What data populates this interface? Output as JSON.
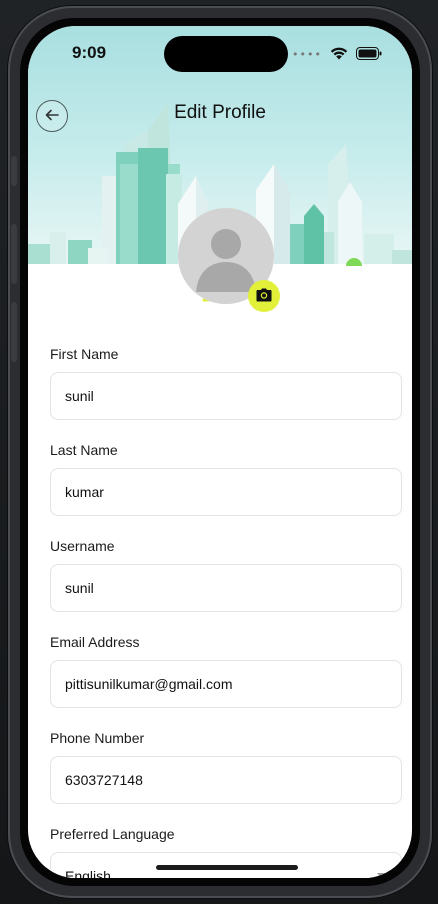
{
  "status_bar": {
    "time": "9:09",
    "signal_dots": "••••"
  },
  "header": {
    "title": "Edit Profile"
  },
  "form": {
    "first_name": {
      "label": "First Name",
      "value": "sunil"
    },
    "last_name": {
      "label": "Last Name",
      "value": "kumar"
    },
    "username": {
      "label": "Username",
      "value": "sunil"
    },
    "email": {
      "label": "Email Address",
      "value": "pittisunilkumar@gmail.com"
    },
    "phone": {
      "label": "Phone Number",
      "value": "6303727148"
    },
    "language": {
      "label": "Preferred Language",
      "value": "English"
    }
  },
  "colors": {
    "accent": "#e3f03a",
    "header_sky": "#a9dfe0",
    "avatar_bg": "#d3d3d3"
  },
  "icons": [
    "back-arrow-icon",
    "wifi-icon",
    "battery-icon",
    "camera-icon",
    "avatar-placeholder-icon",
    "chevron-down-icon"
  ]
}
